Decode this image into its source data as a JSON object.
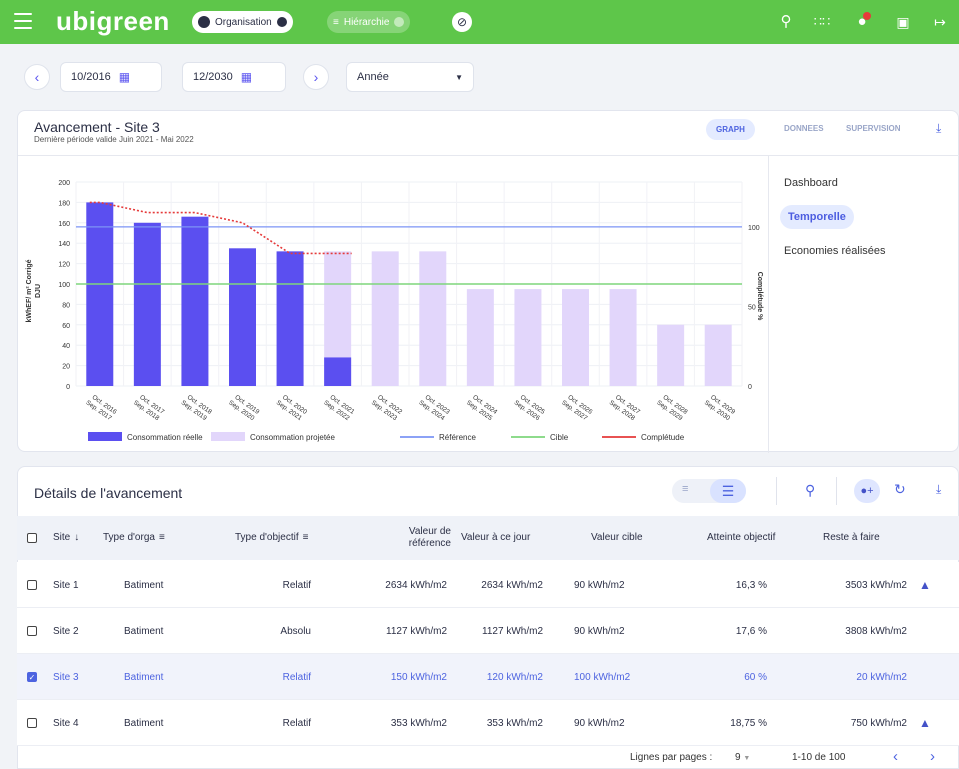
{
  "header": {
    "logo": "ubigreen",
    "org_label": "Organisation",
    "hier_label": "Hiérarchie"
  },
  "icons": [
    "menu-icon",
    "search-icon",
    "apps-icon",
    "bell-icon",
    "contact-icon",
    "logout-icon",
    "calendar-icon",
    "chevron-left-icon",
    "chevron-right-icon",
    "download-icon",
    "refresh-icon",
    "bell-plus-icon",
    "sort-down-icon",
    "filter-icon",
    "indent-icon",
    "list-icon"
  ],
  "colors": {
    "topbar": "#5ec64a",
    "accent": "#4d63e0",
    "bar_real": "#5b4ff0",
    "bar_proj": "#e2d6fb",
    "reference": "#7c94f5",
    "target": "#7ed67c",
    "completude": "#e53a3a"
  },
  "controls": {
    "start_date": "10/2016",
    "end_date": "12/2030",
    "period": "Année"
  },
  "chart_card": {
    "title": "Avancement - Site 3",
    "subtitle": "Dernière période valide Juin 2021 - Mai 2022",
    "tabs": [
      "GRAPH",
      "DONNEES",
      "SUPERVISION"
    ],
    "side": [
      "Dashboard",
      "Temporelle",
      "Economies réalisées"
    ]
  },
  "chart_data": {
    "type": "bar",
    "ylabel": "kWhEF/ m² Corrigé DJU",
    "y2label": "Complétude %",
    "ylim": [
      0,
      200
    ],
    "y2lim": [
      0,
      100
    ],
    "yticks": [
      "200",
      "180",
      "160",
      "140",
      "120",
      "100",
      "80",
      "60",
      "40",
      "20",
      "0"
    ],
    "y2ticks": [
      "100",
      "50",
      "0"
    ],
    "categories": [
      "Oct. 2016 Sep. 2017",
      "Oct. 2017 Sep. 2018",
      "Oct. 2018 Sep. 2019",
      "Oct. 2019 Sep. 2020",
      "Oct. 2020 Sep. 2021",
      "Oct. 2021 Sep. 2022",
      "Oct. 2022 Sep. 2023",
      "Oct. 2023 Sep. 2024",
      "Oct. 2024 Sep. 2025",
      "Oct. 2025 Sep. 2026",
      "Oct. 2026 Sep. 2027",
      "Oct. 2027 Sep. 2028",
      "Oct. 2028 Sep. 2029",
      "Oct. 2029 Sep. 2030"
    ],
    "series": [
      {
        "name": "Consommation réelle",
        "values": [
          180,
          160,
          166,
          135,
          132,
          28,
          null,
          null,
          null,
          null,
          null,
          null,
          null,
          null
        ]
      },
      {
        "name": "Consommation projetée",
        "values": [
          null,
          null,
          null,
          null,
          null,
          132,
          132,
          132,
          95,
          95,
          95,
          95,
          60,
          60
        ]
      },
      {
        "name": "Référence",
        "values": [
          156,
          156,
          156,
          156,
          156,
          156,
          156,
          156,
          156,
          156,
          156,
          156,
          156,
          156
        ]
      },
      {
        "name": "Cible",
        "values": [
          100,
          100,
          100,
          100,
          100,
          100,
          100,
          100,
          100,
          100,
          100,
          100,
          100,
          100
        ]
      },
      {
        "name": "Complétude",
        "values": [
          180,
          170,
          170,
          160,
          130,
          130,
          null,
          null,
          null,
          null,
          null,
          null,
          null,
          null
        ]
      }
    ],
    "legend": "bottom"
  },
  "details": {
    "title": "Détails de l'avancement",
    "columns": [
      "Site",
      "Type d'orga",
      "Type d'objectif",
      "Valeur de référence",
      "Valeur à ce jour",
      "Valeur cible",
      "Atteinte objectif",
      "Reste à faire"
    ],
    "rows": [
      {
        "site": "Site 1",
        "orga": "Batiment",
        "objectif": "Relatif",
        "ref": "2634 kWh/m2",
        "jour": "2634 kWh/m2",
        "cible": "90 kWh/m2",
        "atteinte": "16,3 %",
        "reste": "3503 kWh/m2"
      },
      {
        "site": "Site 2",
        "orga": "Batiment",
        "objectif": "Absolu",
        "ref": "1127 kWh/m2",
        "jour": "1127 kWh/m2",
        "cible": "90 kWh/m2",
        "atteinte": "17,6 %",
        "reste": "3808 kWh/m2"
      },
      {
        "site": "Site 3",
        "orga": "Batiment",
        "objectif": "Relatif",
        "ref": "150 kWh/m2",
        "jour": "120 kWh/m2",
        "cible": "100 kWh/m2",
        "atteinte": "60 %",
        "reste": "20 kWh/m2"
      },
      {
        "site": "Site 4",
        "orga": "Batiment",
        "objectif": "Relatif",
        "ref": "353 kWh/m2",
        "jour": "353 kWh/m2",
        "cible": "90 kWh/m2",
        "atteinte": "18,75 %",
        "reste": "750 kWh/m2"
      }
    ],
    "pagination": {
      "label": "Lignes par pages :",
      "per_page": "9",
      "range": "1-10 de 100"
    }
  }
}
